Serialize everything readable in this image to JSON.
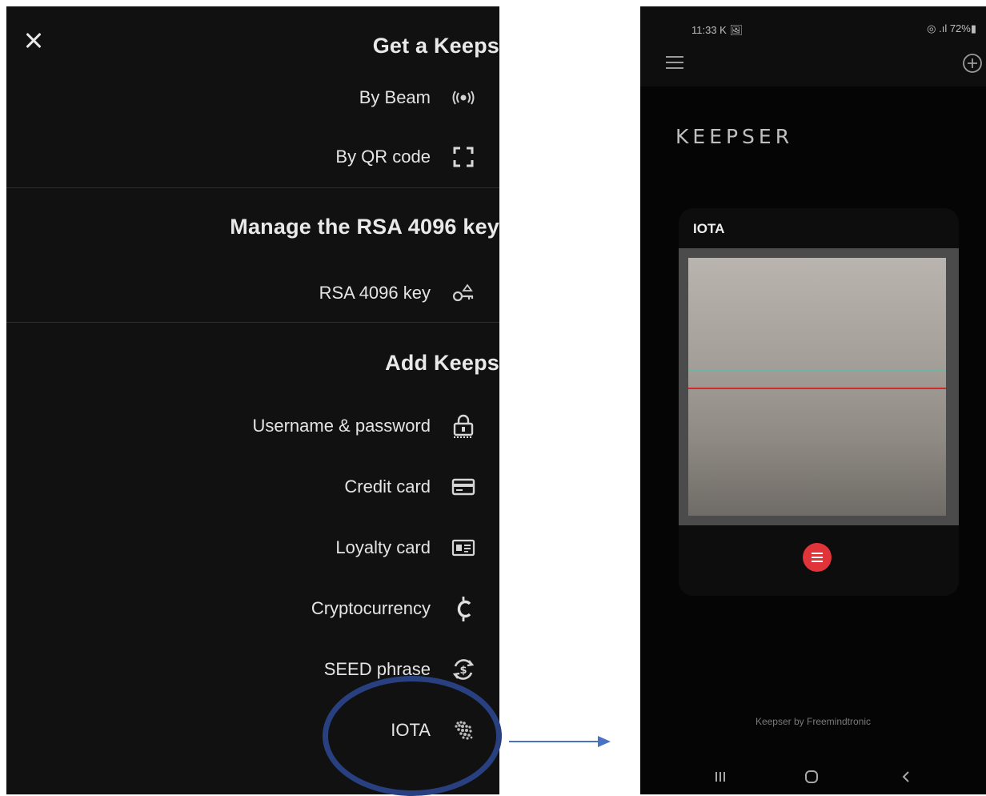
{
  "menu": {
    "close_icon": "close-icon",
    "sections": [
      {
        "title": "Get a Keeps",
        "items": [
          {
            "label": "By Beam",
            "icon": "beam-icon"
          },
          {
            "label": "By QR code",
            "icon": "qr-scan-icon"
          }
        ]
      },
      {
        "title": "Manage the RSA 4096 key",
        "items": [
          {
            "label": "RSA 4096 key",
            "icon": "key-icon"
          }
        ]
      },
      {
        "title": "Add Keeps",
        "items": [
          {
            "label": "Username & password",
            "icon": "lock-icon"
          },
          {
            "label": "Credit card",
            "icon": "credit-card-icon"
          },
          {
            "label": "Loyalty card",
            "icon": "id-card-icon"
          },
          {
            "label": "Cryptocurrency",
            "icon": "crypto-icon"
          },
          {
            "label": "SEED phrase",
            "icon": "seed-icon"
          },
          {
            "label": "IOTA",
            "icon": "iota-icon"
          }
        ]
      }
    ]
  },
  "phone": {
    "status": {
      "time": "11:33 K 🖼",
      "right": "◎ .ıl 72%▮"
    },
    "brand": "KEEPSER",
    "card": {
      "title": "IOTA"
    },
    "footer": "Keepser by Freemindtronic"
  },
  "colors": {
    "menu_bg": "#111111",
    "annotation": "#283f80",
    "arrow": "#4a72c4",
    "fab": "#e0343a",
    "scan_line": "#d22a2a"
  }
}
